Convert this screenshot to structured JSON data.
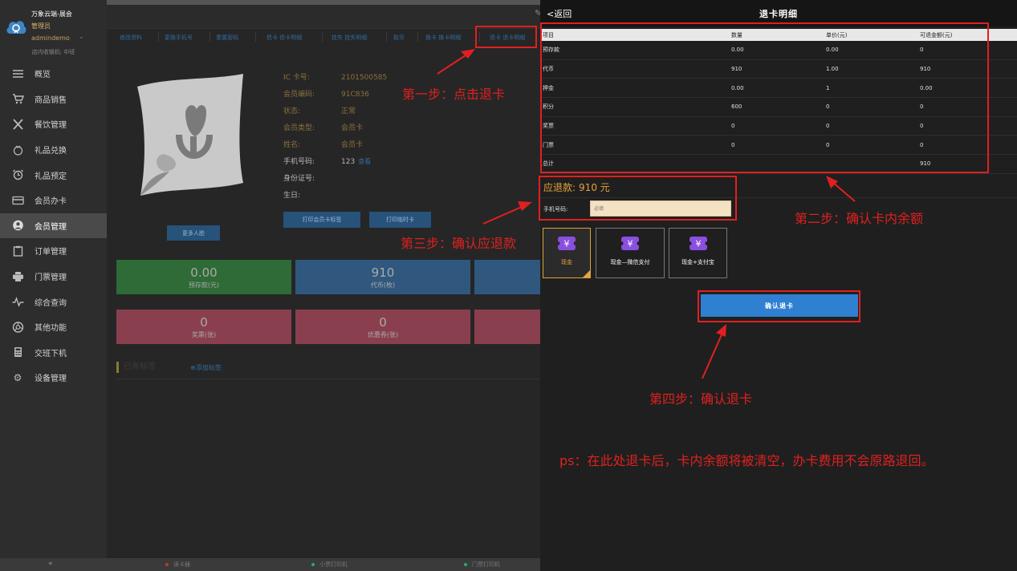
{
  "sidebar": {
    "brand_title": "万象云端-展会",
    "role": "管理员",
    "user": "admindemo",
    "cashier": "店内收银机: 中班",
    "items": [
      {
        "label": "概览",
        "icon": "menu-icon"
      },
      {
        "label": "商品销售",
        "icon": "cart-icon"
      },
      {
        "label": "餐饮管理",
        "icon": "fork-knife-icon"
      },
      {
        "label": "礼品兑换",
        "icon": "gift-icon"
      },
      {
        "label": "礼品预定",
        "icon": "alarm-clock-icon"
      },
      {
        "label": "会员办卡",
        "icon": "card-icon"
      },
      {
        "label": "会员管理",
        "icon": "user-icon",
        "active": true
      },
      {
        "label": "订单管理",
        "icon": "clipboard-icon"
      },
      {
        "label": "门票管理",
        "icon": "printer-icon"
      },
      {
        "label": "综合查询",
        "icon": "pulse-icon"
      },
      {
        "label": "其他功能",
        "icon": "aperture-icon"
      },
      {
        "label": "交班下机",
        "icon": "calculator-icon"
      },
      {
        "label": "设备管理",
        "icon": "gear-icon"
      }
    ]
  },
  "footer": {
    "collapse": "«",
    "items": [
      {
        "label": "读卡器",
        "color": "#c0392b"
      },
      {
        "label": "小票打印机",
        "color": "#27ae60"
      },
      {
        "label": "门票打印机",
        "color": "#27ae60"
      }
    ]
  },
  "member": {
    "tabs": [
      "修改资料",
      "更换手机号",
      "重置密码",
      "债卡 债卡明细",
      "挂失 挂失明细",
      "取币",
      "换卡 换卡明细",
      "退卡 退卡明细"
    ],
    "more_faces": "更多人脸",
    "info": [
      {
        "label": "IC 卡号:",
        "value": "2101500585",
        "style": "gold"
      },
      {
        "label": "会员编码:",
        "value": "91C836",
        "style": "gold"
      },
      {
        "label": "状态:",
        "value": "正常",
        "style": "gold"
      },
      {
        "label": "会员类型:",
        "value": "会员卡",
        "style": "gold"
      },
      {
        "label": "姓名:",
        "value": "会员卡",
        "style": "gold"
      },
      {
        "label": "手机号码:",
        "value": "123",
        "link": "查看",
        "style": "plain"
      },
      {
        "label": "身份证号:",
        "value": "",
        "style": "plain"
      },
      {
        "label": "生日:",
        "value": "",
        "style": "plain"
      }
    ],
    "print_card_label": "打印会员卡标签",
    "print_temp_card": "打印临时卡",
    "stats_row1": [
      {
        "value": "0.00",
        "label": "预存款(元)",
        "color": "#2e6b36"
      },
      {
        "value": "910",
        "label": "代币(枚)",
        "color": "#30587f"
      },
      {
        "value": "",
        "label": "",
        "color": "#30587f"
      }
    ],
    "stats_row2": [
      {
        "value": "0",
        "label": "奖票(张)",
        "color": "#8a3f4f"
      },
      {
        "value": "0",
        "label": "优惠券(张)",
        "color": "#8a3f4f"
      },
      {
        "value": "",
        "label": "",
        "color": "#8a3f4f"
      }
    ],
    "tags_title": "已有标签",
    "add_tag": "添加标签"
  },
  "refund": {
    "back": "返回",
    "title": "退卡明细",
    "headers": [
      "项目",
      "数量",
      "单价(元)",
      "可退金额(元)"
    ],
    "rows": [
      [
        "预存款",
        "0.00",
        "0.00",
        "0"
      ],
      [
        "代币",
        "910",
        "1.00",
        "910"
      ],
      [
        "押金",
        "0.00",
        "1",
        "0.00"
      ],
      [
        "积分",
        "600",
        "0",
        "0"
      ],
      [
        "奖票",
        "0",
        "0",
        "0"
      ],
      [
        "门票",
        "0",
        "0",
        "0"
      ],
      [
        "总计",
        "",
        "",
        "910"
      ]
    ],
    "amount_label": "应退款:",
    "amount_value": "910 元",
    "phone_label": "手机号码:",
    "phone_placeholder": "必填",
    "pay_options": [
      "现金",
      "现金—微信支付",
      "现金+支付宝"
    ],
    "confirm": "确认退卡"
  },
  "annotations": {
    "step1": "第一步：点击退卡",
    "step2": "第二步：确认卡内余额",
    "step3": "第三步：确认应退款",
    "step4": "第四步：确认退卡",
    "ps": "ps：在此处退卡后，卡内余额将被清空，办卡费用不会原路退回。"
  },
  "colors": {
    "accent_blue": "#2f80d1",
    "refund_gold": "#e8a23c",
    "annotation_red": "#e02020",
    "pay_purple": "#8b4fe0"
  }
}
